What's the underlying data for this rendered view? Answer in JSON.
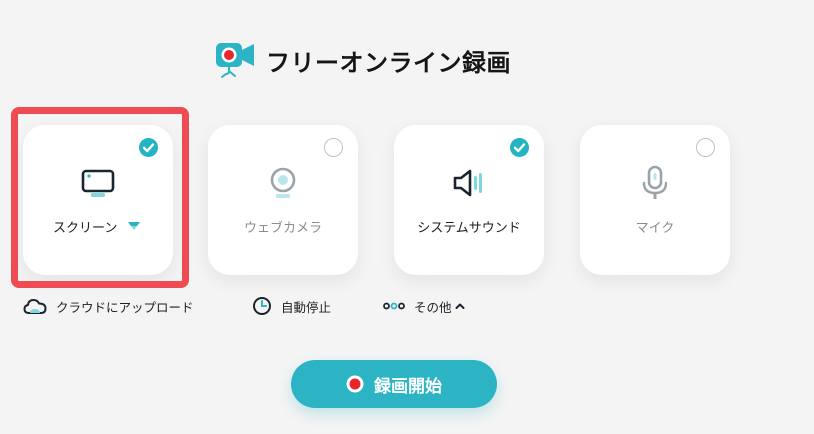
{
  "header": {
    "title": "フリーオンライン録画",
    "logo_icon": "webcam-recorder-icon"
  },
  "sources": [
    {
      "id": "screen",
      "label": "スクリーン",
      "checked": true,
      "icon": "monitor-icon",
      "has_dropdown": true
    },
    {
      "id": "webcam",
      "label": "ウェブカメラ",
      "checked": false,
      "icon": "webcam-icon"
    },
    {
      "id": "sound",
      "label": "システムサウンド",
      "checked": true,
      "icon": "speaker-icon"
    },
    {
      "id": "mic",
      "label": "マイク",
      "checked": false,
      "icon": "microphone-icon"
    }
  ],
  "options": {
    "cloud_label": "クラウドにアップロード",
    "timer_label": "自動停止",
    "other_label": "その他"
  },
  "start_button": {
    "label": "録画開始"
  },
  "colors": {
    "accent": "#23b3c3",
    "highlight": "#ee4c52",
    "record_red": "#e8262c"
  }
}
